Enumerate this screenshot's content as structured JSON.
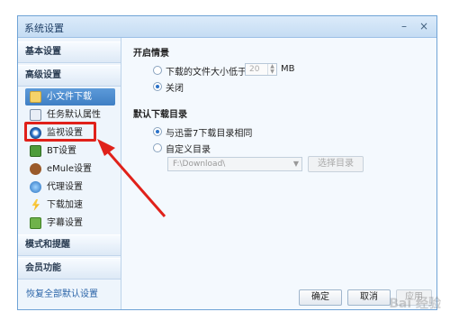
{
  "window": {
    "title": "系统设置"
  },
  "sidebar": {
    "groups": {
      "basic": "基本设置",
      "advanced": "高级设置",
      "mode": "模式和提醒",
      "member": "会员功能"
    },
    "items": [
      {
        "label": "小文件下载",
        "icon": "small-file-download-icon"
      },
      {
        "label": "任务默认属性",
        "icon": "task-properties-icon"
      },
      {
        "label": "监视设置",
        "icon": "monitor-icon"
      },
      {
        "label": "BT设置",
        "icon": "bt-icon"
      },
      {
        "label": "eMule设置",
        "icon": "emule-icon"
      },
      {
        "label": "代理设置",
        "icon": "proxy-icon"
      },
      {
        "label": "下载加速",
        "icon": "download-accelerate-icon"
      },
      {
        "label": "字幕设置",
        "icon": "subtitle-icon"
      }
    ],
    "selected_index": 0,
    "reset_link": "恢复全部默认设置"
  },
  "content": {
    "enable_section": {
      "title": "开启情景",
      "option1_label": "下载的文件大小低于",
      "size_value": "20",
      "size_unit": "MB",
      "option2_label": "关闭",
      "selected": "option2"
    },
    "dir_section": {
      "title": "默认下载目录",
      "option1_label": "与迅雷7下载目录相同",
      "option2_label": "自定义目录",
      "selected": "option1",
      "path_value": "F:\\Download\\",
      "browse_label": "选择目录"
    }
  },
  "footer": {
    "ok_label": "确定",
    "cancel_label": "取消",
    "apply_label": "应用"
  },
  "colors": {
    "highlight": "#e0211a",
    "selected_item": "#4a88cc"
  },
  "watermark": "Bai 经验"
}
